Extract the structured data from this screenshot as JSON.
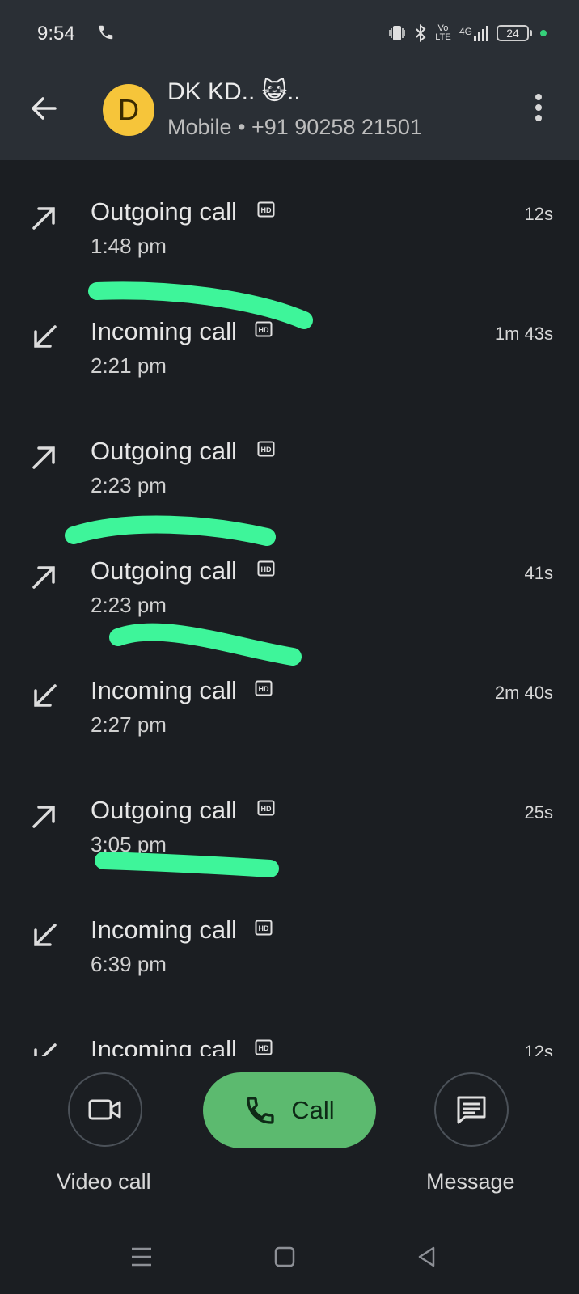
{
  "status_bar": {
    "time": "9:54",
    "network": "4G",
    "volte": "Vo LTE",
    "battery": "24"
  },
  "header": {
    "avatar_letter": "D",
    "contact_name": "DK KD.. 😺..",
    "contact_subtitle": "Mobile • +91 90258 21501"
  },
  "calls": [
    {
      "type": "Outgoing call",
      "direction": "outgoing",
      "time": "1:48 pm",
      "duration": "12s"
    },
    {
      "type": "Incoming call",
      "direction": "incoming",
      "time": "2:21 pm",
      "duration": "1m 43s"
    },
    {
      "type": "Outgoing call",
      "direction": "outgoing",
      "time": "2:23 pm",
      "duration": ""
    },
    {
      "type": "Outgoing call",
      "direction": "outgoing",
      "time": "2:23 pm",
      "duration": "41s"
    },
    {
      "type": "Incoming call",
      "direction": "incoming",
      "time": "2:27 pm",
      "duration": "2m 40s"
    },
    {
      "type": "Outgoing call",
      "direction": "outgoing",
      "time": "3:05 pm",
      "duration": "25s"
    },
    {
      "type": "Incoming call",
      "direction": "incoming",
      "time": "6:39 pm",
      "duration": ""
    },
    {
      "type": "Incoming call",
      "direction": "incoming",
      "time": "",
      "duration": "12s"
    }
  ],
  "actions": {
    "video_call_label": "Video call",
    "call_label": "Call",
    "message_label": "Message"
  },
  "colors": {
    "background": "#1b1e22",
    "header": "#2a2f35",
    "avatar": "#f6c53a",
    "call_button": "#5cba6f",
    "highlight_marker": "#3ef59a"
  },
  "icons": {
    "back": "arrow-left-icon",
    "more": "more-vert-icon",
    "outgoing": "arrow-up-right-icon",
    "incoming": "arrow-down-left-icon",
    "hd": "hd-icon",
    "video": "videocam-icon",
    "phone": "phone-icon",
    "message": "message-icon"
  }
}
